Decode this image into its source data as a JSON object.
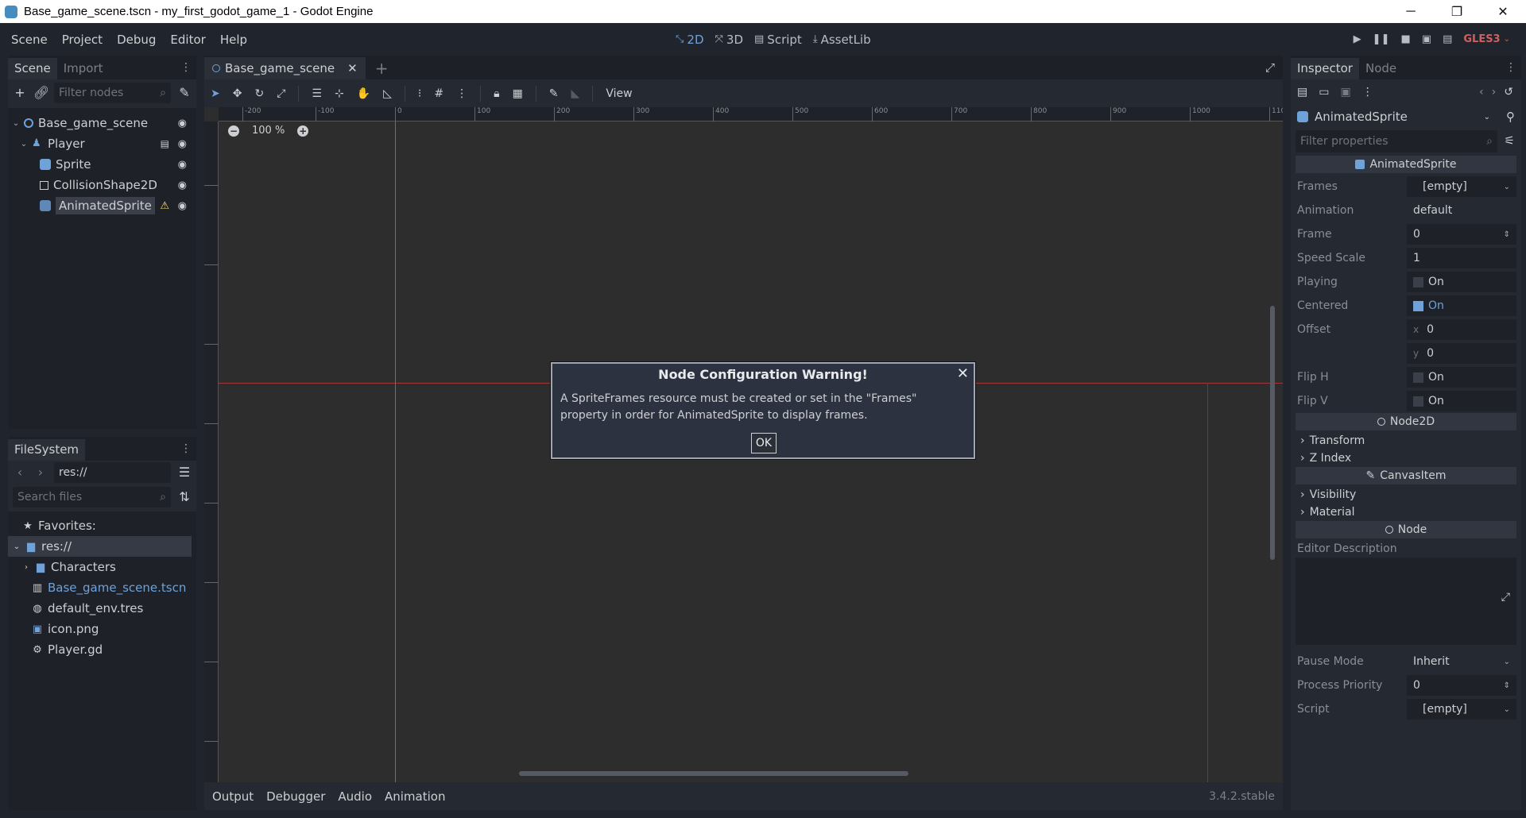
{
  "window": {
    "title": "Base_game_scene.tscn - my_first_godot_game_1 - Godot Engine",
    "controls": [
      "─",
      "❐",
      "✕"
    ]
  },
  "menu": [
    "Scene",
    "Project",
    "Debug",
    "Editor",
    "Help"
  ],
  "workspaces": [
    {
      "label": "2D",
      "icon": "2d-icon",
      "active": true
    },
    {
      "label": "3D",
      "icon": "3d-icon",
      "active": false
    },
    {
      "label": "Script",
      "icon": "script-icon",
      "active": false
    },
    {
      "label": "AssetLib",
      "icon": "assetlib-icon",
      "active": false
    }
  ],
  "renderer": "GLES3",
  "scene_dock": {
    "tabs": [
      "Scene",
      "Import"
    ],
    "filter_placeholder": "Filter nodes",
    "nodes": [
      {
        "label": "Base_game_scene",
        "depth": 0
      },
      {
        "label": "Player",
        "depth": 1
      },
      {
        "label": "Sprite",
        "depth": 2
      },
      {
        "label": "CollisionShape2D",
        "depth": 2
      },
      {
        "label": "AnimatedSprite",
        "depth": 2
      }
    ]
  },
  "filesystem": {
    "tab": "FileSystem",
    "path": "res://",
    "search_placeholder": "Search files",
    "favorites": "Favorites:",
    "root": "res://",
    "items": [
      {
        "label": "Characters",
        "icon": "folder-icon"
      },
      {
        "label": "Base_game_scene.tscn",
        "icon": "scene-file-icon"
      },
      {
        "label": "default_env.tres",
        "icon": "environment-icon"
      },
      {
        "label": "icon.png",
        "icon": "image-icon"
      },
      {
        "label": "Player.gd",
        "icon": "gear-icon"
      }
    ]
  },
  "editor": {
    "scene_tab": "Base_game_scene",
    "view_menu": "View",
    "zoom": "100 %",
    "ruler_ticks": [
      "-200",
      "-100",
      "0",
      "100",
      "200",
      "300",
      "400",
      "500",
      "600",
      "700",
      "800",
      "900",
      "1000",
      "110"
    ]
  },
  "bottom_panel": {
    "tabs": [
      "Output",
      "Debugger",
      "Audio",
      "Animation"
    ],
    "version": "3.4.2.stable"
  },
  "inspector": {
    "tabs": [
      "Inspector",
      "Node"
    ],
    "object": "AnimatedSprite",
    "filter_placeholder": "Filter properties",
    "section_animated": "AnimatedSprite",
    "frames": {
      "label": "Frames",
      "value": "[empty]"
    },
    "animation": {
      "label": "Animation",
      "value": "default"
    },
    "frame": {
      "label": "Frame",
      "value": "0"
    },
    "speed_scale": {
      "label": "Speed Scale",
      "value": "1"
    },
    "playing": {
      "label": "Playing",
      "value": "On",
      "checked": false
    },
    "centered": {
      "label": "Centered",
      "value": "On",
      "checked": true
    },
    "offset": {
      "label": "Offset",
      "x_label": "x",
      "x": "0",
      "y_label": "y",
      "y": "0"
    },
    "flip_h": {
      "label": "Flip H",
      "value": "On",
      "checked": false
    },
    "flip_v": {
      "label": "Flip V",
      "value": "On",
      "checked": false
    },
    "section_node2d": "Node2D",
    "transform": "Transform",
    "z_index": "Z Index",
    "section_canvasitem": "CanvasItem",
    "visibility": "Visibility",
    "material": "Material",
    "section_node": "Node",
    "editor_description": "Editor Description",
    "pause_mode": {
      "label": "Pause Mode",
      "value": "Inherit"
    },
    "process_priority": {
      "label": "Process Priority",
      "value": "0"
    },
    "script": {
      "label": "Script",
      "value": "[empty]"
    }
  },
  "dialog": {
    "title": "Node Configuration Warning!",
    "message": "A SpriteFrames resource must be created or set in the \"Frames\" property in order for AnimatedSprite to display frames.",
    "ok": "OK"
  },
  "colors": {
    "accent": "#6ea2d9",
    "warning": "#ffdd65",
    "x_axis": "#a03a3a",
    "y_axis": "#6a7f2e"
  }
}
